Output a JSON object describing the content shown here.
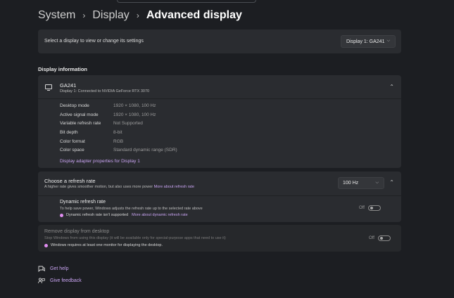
{
  "breadcrumb": {
    "item1": "System",
    "item2": "Display",
    "current": "Advanced display",
    "separator": "›"
  },
  "display_select": {
    "label": "Select a display to view or change its settings",
    "value": "Display 1: GA241"
  },
  "display_info": {
    "section_title": "Display information",
    "monitor_name": "GA241",
    "monitor_sub": "Display 1: Connected to NVIDIA GeForce RTX 3070",
    "rows": [
      {
        "key": "Desktop mode",
        "value": "1920 × 1080, 100 Hz"
      },
      {
        "key": "Active signal mode",
        "value": "1920 × 1080, 100 Hz"
      },
      {
        "key": "Variable refresh rate",
        "value": "Not Supported"
      },
      {
        "key": "Bit depth",
        "value": "8-bit"
      },
      {
        "key": "Color format",
        "value": "RGB"
      },
      {
        "key": "Color space",
        "value": "Standard dynamic range (SDR)"
      }
    ],
    "adapter_link": "Display adapter properties for Display 1"
  },
  "refresh": {
    "title": "Choose a refresh rate",
    "subtitle": "A higher rate gives smoother motion, but also uses more power",
    "more_link": "More about refresh rate",
    "value": "100 Hz",
    "dynamic": {
      "title": "Dynamic refresh rate",
      "subtitle": "To help save power, Windows adjusts the refresh rate up to the selected rate above",
      "note": "Dynamic refresh rate isn't supported",
      "more_link": "More about dynamic refresh rate",
      "toggle_label": "Off"
    }
  },
  "remove_display": {
    "title": "Remove display from desktop",
    "subtitle": "Stop Windows from using this display (it will be available only for special-purpose apps that need to use it)",
    "note": "Windows requires at least one monitor for displaying the desktop.",
    "toggle_label": "Off"
  },
  "footer": {
    "help": "Get help",
    "feedback": "Give feedback"
  },
  "colors": {
    "background": "#1c1e22",
    "card": "#2a2c30",
    "link": "#c9a4f2",
    "info_dot": "#e08df0"
  }
}
